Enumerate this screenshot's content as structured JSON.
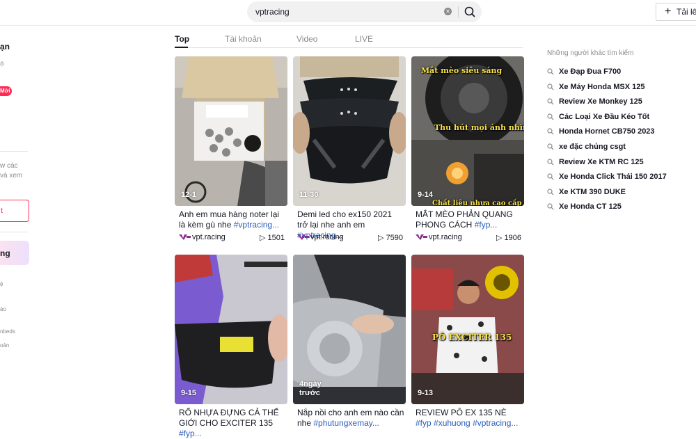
{
  "search": {
    "value": "vptracing",
    "upload_label": "Tải lê"
  },
  "sidebar": {
    "title": "ạn",
    "dot": "ạ",
    "badge": "Mới",
    "desc_line1": "w các",
    "desc_line2": "và xem",
    "login_label": "t",
    "promo_label": "ng",
    "footer": [
      "ệ",
      "ảo",
      "nbeds",
      "oản"
    ]
  },
  "tabs": [
    "Top",
    "Tài khoản",
    "Video",
    "LIVE"
  ],
  "videos": [
    {
      "badge": "12-1",
      "caption": "Anh em mua hàng noter lại là kèm gù nhe ",
      "hashtag": "#vptracing...",
      "author": "vpt.racing",
      "views": "1501",
      "overlay": ""
    },
    {
      "badge": "11-30",
      "caption": "Demi led cho ex150 2021 trở lại nhe anh em ",
      "hashtag": "#vptracing...",
      "author": "vpt.racing",
      "views": "7590",
      "overlay": ""
    },
    {
      "badge": "9-14",
      "caption": "MẮT MÈO PHẢN QUANG PHONG CÁCH ",
      "hashtag": "#fyp...",
      "author": "vpt.racing",
      "views": "1906",
      "overlay": "Mắt mèo siêu sáng",
      "overlay2": "Thu hút mọi ánh nhìn",
      "overlay3": "Chất liệu nhựa cao cấp"
    },
    {
      "badge": "9-15",
      "caption": "RỔ NHỰA ĐỰNG CẢ THẾ GIỚI CHO EXCITER 135 ",
      "hashtag": "#fyp...",
      "author": "",
      "views": "",
      "overlay": ""
    },
    {
      "badge": "4ngày\ntrước",
      "caption": "Nắp nồi cho anh em nào cần nhe ",
      "hashtag": "#phutungxemay...",
      "author": "",
      "views": "",
      "overlay": ""
    },
    {
      "badge": "9-13",
      "caption": "REVIEW PÔ EX 135 NÈ ",
      "hashtag": "#fyp #xuhuong #vptracing...",
      "author": "",
      "views": "",
      "overlay": "PÔ EXCITER 135"
    }
  ],
  "related": {
    "title": "Những người khác tìm kiếm",
    "items": [
      "Xe Đạp Đua F700",
      "Xe Máy Honda MSX 125",
      "Review Xe Monkey 125",
      "Các Loại Xe Đầu Kéo Tốt",
      "Honda Hornet CB750 2023",
      "xe đặc chủng csgt",
      "Review Xe KTM RC 125",
      "Xe Honda Click Thái 150 2017",
      "Xe KTM 390 DUKE",
      "Xe Honda CT 125"
    ]
  },
  "colors": {
    "accent": "#fe2c55",
    "hashtag": "#2b5db9",
    "text": "#161823",
    "muted": "#8a8b91"
  }
}
